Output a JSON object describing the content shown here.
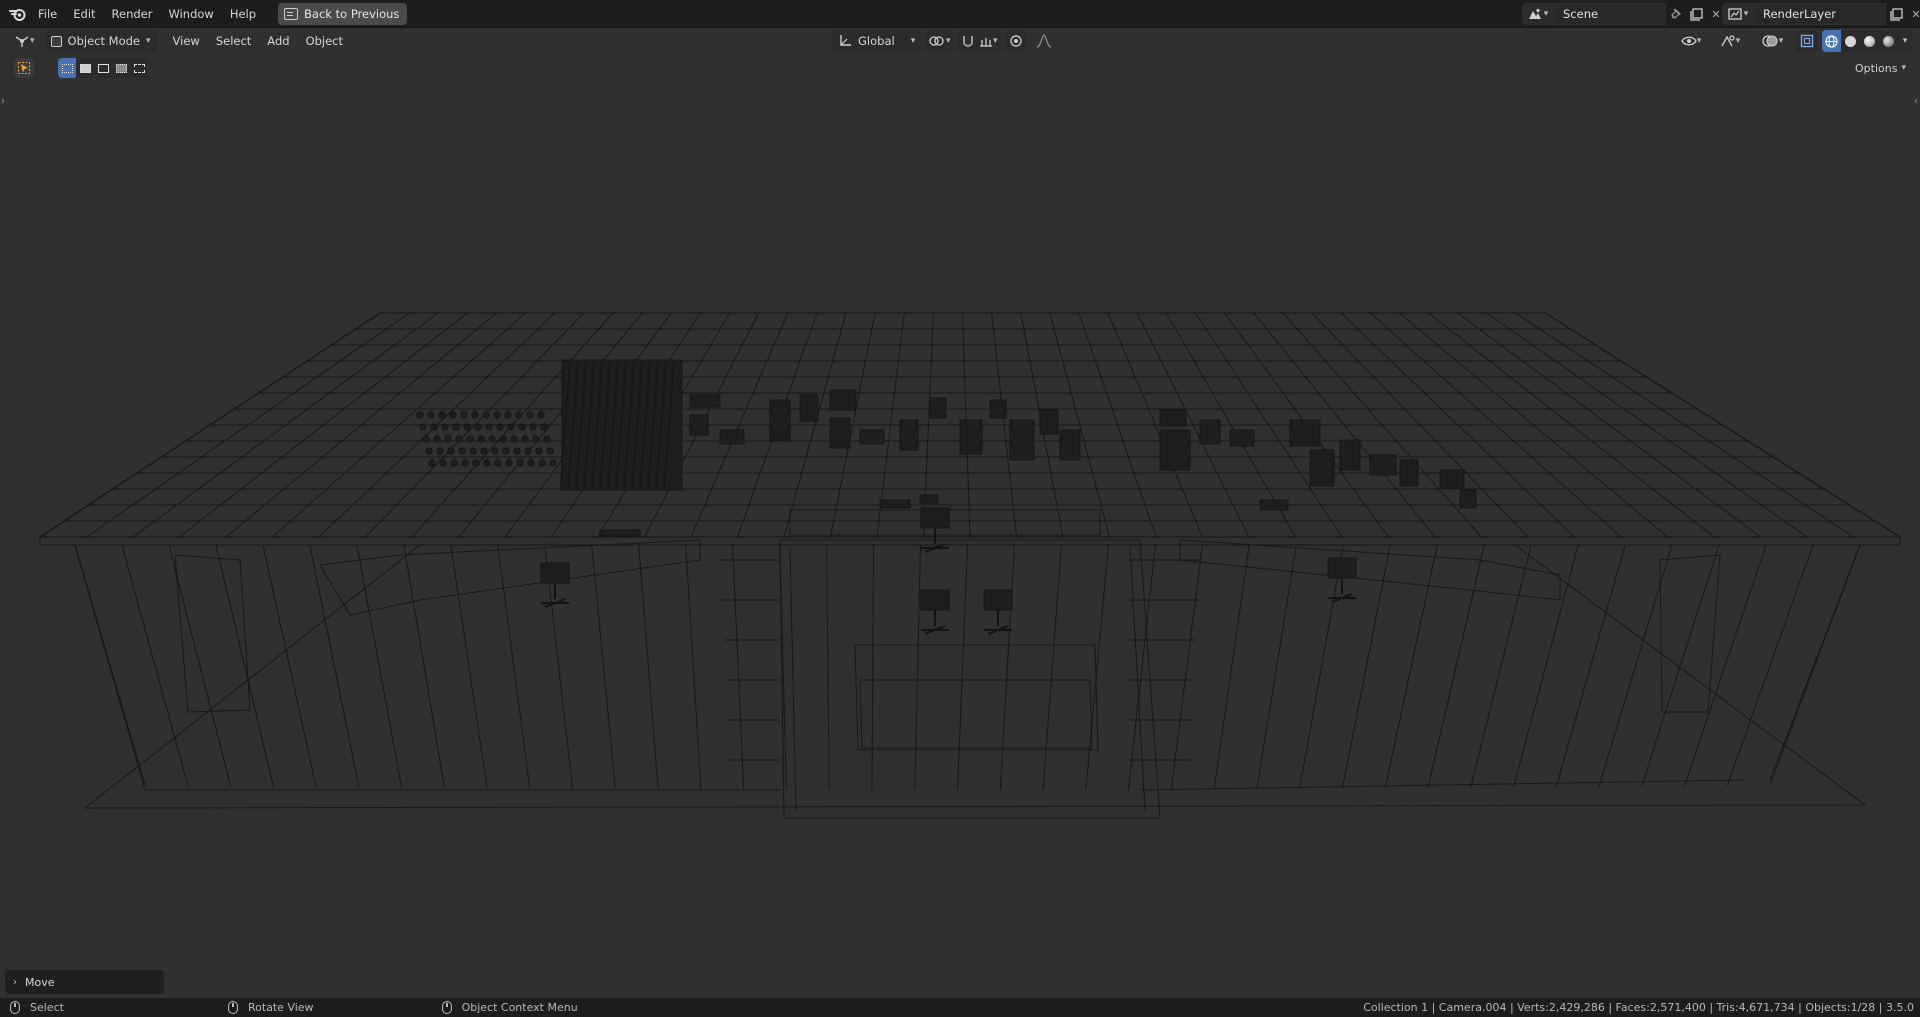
{
  "topbar": {
    "menus": [
      "File",
      "Edit",
      "Render",
      "Window",
      "Help"
    ],
    "back_label": "Back to Previous",
    "scene_name": "Scene",
    "view_layer_name": "RenderLayer"
  },
  "header": {
    "mode_label": "Object Mode",
    "menus": [
      "View",
      "Select",
      "Add",
      "Object"
    ],
    "orientation_label": "Global",
    "options_label": "Options"
  },
  "operator_panel": {
    "label": "Move"
  },
  "statusbar": {
    "hints": [
      {
        "label": "Select"
      },
      {
        "label": "Rotate View"
      },
      {
        "label": "Object Context Menu"
      }
    ],
    "stats": "Collection 1 | Camera.004 | Verts:2,429,286 | Faces:2,571,400 | Tris:4,671,734 | Objects:1/28 | 3.5.0"
  },
  "colors": {
    "accent": "#4772b3",
    "background": "#303030",
    "wire": "#141414"
  },
  "icons": {
    "logo": "blender-logo-icon",
    "scene": "scene-icon",
    "view_layer": "render-layer-icon",
    "pin": "pin-icon",
    "new": "duplicate-icon",
    "close": "close-icon"
  }
}
